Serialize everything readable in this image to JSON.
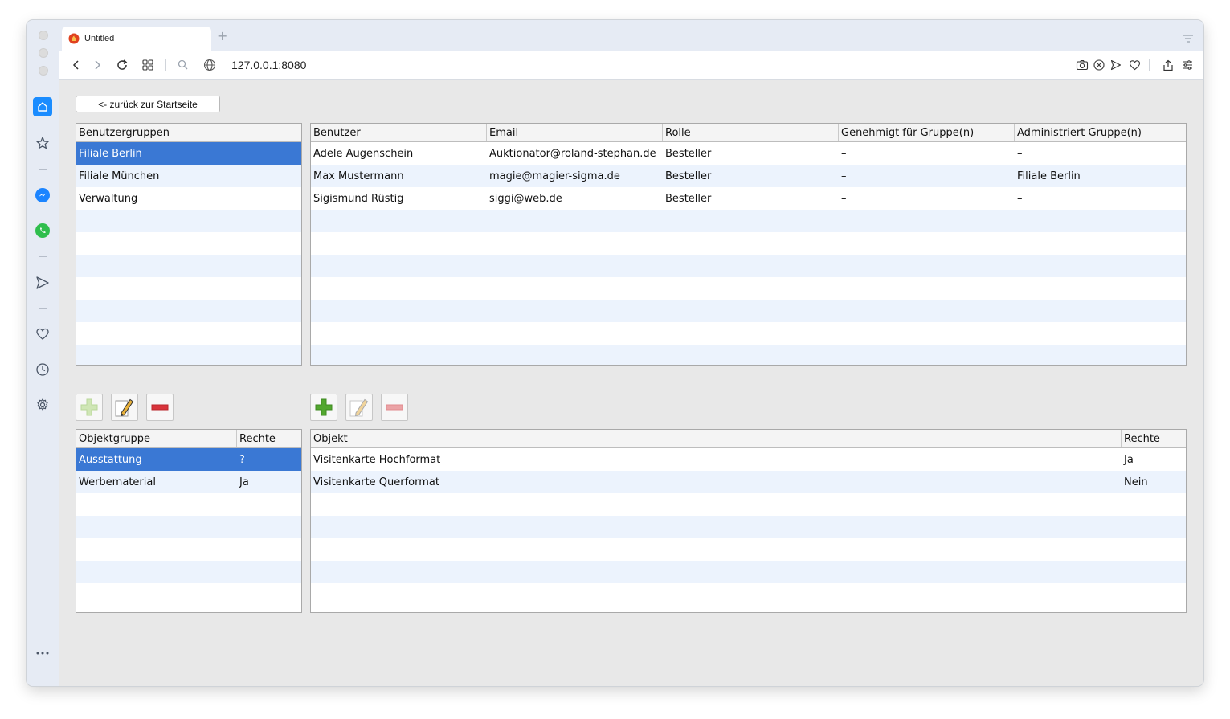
{
  "browser": {
    "tab_title": "Untitled",
    "url": "127.0.0.1:8080"
  },
  "page": {
    "back_button": "<- zurück zur Startseite"
  },
  "groups": {
    "header": "Benutzergruppen",
    "items": [
      "Filiale Berlin",
      "Filiale München",
      "Verwaltung"
    ],
    "selected_index": 0
  },
  "users": {
    "headers": [
      "Benutzer",
      "Email",
      "Rolle",
      "Genehmigt für Gruppe(n)",
      "Administriert Gruppe(n)"
    ],
    "rows": [
      [
        "Adele Augenschein",
        "Auktionator@roland-stephan.de",
        "Besteller",
        "–",
        "–"
      ],
      [
        "Max Mustermann",
        "magie@magier-sigma.de",
        "Besteller",
        "–",
        "Filiale Berlin"
      ],
      [
        "Sigismund Rüstig",
        "siggi@web.de",
        "Besteller",
        "–",
        "–"
      ]
    ]
  },
  "object_groups": {
    "headers": [
      "Objektgruppe",
      "Rechte"
    ],
    "rows": [
      [
        "Ausstattung",
        "?"
      ],
      [
        "Werbematerial",
        "Ja"
      ]
    ],
    "selected_index": 0
  },
  "objects": {
    "headers": [
      "Objekt",
      "Rechte"
    ],
    "rows": [
      [
        "Visitenkarte Hochformat",
        "Ja"
      ],
      [
        "Visitenkarte Querformat",
        "Nein"
      ]
    ]
  },
  "colors": {
    "selection": "#3a78d4",
    "alt_row": "#ecf3fd",
    "accent": "#1a8cff"
  }
}
